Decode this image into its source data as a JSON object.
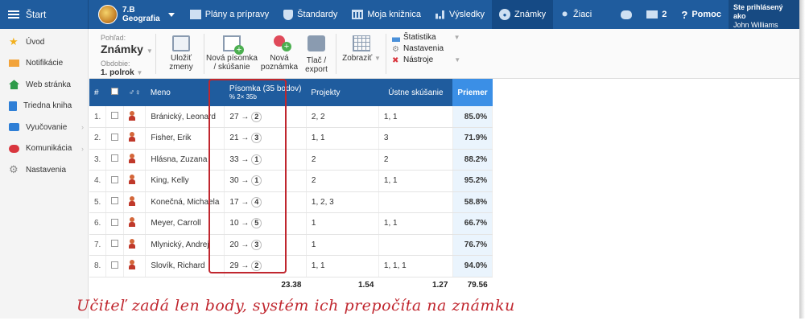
{
  "topbar": {
    "start_label": "Štart",
    "class_name": "7.B",
    "subject": "Geografia",
    "nav": [
      {
        "label": "Plány a prípravy",
        "icon": "board-icon"
      },
      {
        "label": "Štandardy",
        "icon": "shield-icon"
      },
      {
        "label": "Moja knižnica",
        "icon": "library-icon"
      },
      {
        "label": "Výsledky",
        "icon": "bar-chart-icon"
      },
      {
        "label": "Známky",
        "icon": "grade-icon",
        "active": true
      },
      {
        "label": "Žiaci",
        "icon": "students-icon"
      }
    ],
    "mail_count": "2",
    "help_label": "Pomoc",
    "user_prefix": "Ste prihlásený ako",
    "user_name": "John Williams"
  },
  "sidebar": {
    "items": [
      {
        "label": "Úvod",
        "icon": "star-icon"
      },
      {
        "label": "Notifikácie",
        "icon": "envelope-icon"
      },
      {
        "label": "Web stránka",
        "icon": "house-icon"
      },
      {
        "label": "Triedna kniha",
        "icon": "book-icon"
      },
      {
        "label": "Vyučovanie",
        "icon": "classroom-icon",
        "submenu": true
      },
      {
        "label": "Komunikácia",
        "icon": "chat-icon",
        "submenu": true
      },
      {
        "label": "Nastavenia",
        "icon": "gear-icon"
      }
    ]
  },
  "toolbar": {
    "view_label": "Pohľad:",
    "view_value": "Známky",
    "period_label": "Obdobie:",
    "period_value": "1. polrok",
    "save_line1": "Uložiť",
    "save_line2": "zmeny",
    "new_test_line1": "Nová písomka",
    "new_test_line2": "/ skúšanie",
    "new_note_line1": "Nová",
    "new_note_line2": "poznámka",
    "print_line1": "Tlač /",
    "print_line2": "export",
    "display_label": "Zobraziť",
    "stats_label": "Štatistika",
    "settings_label": "Nastavenia",
    "tools_label": "Nástroje"
  },
  "table": {
    "headers": {
      "num": "#",
      "gender": "♂♀",
      "name": "Meno",
      "test_title": "Písomka (35 bodov)",
      "test_sub": "%  2×  35b",
      "projects": "Projekty",
      "oral": "Ústne skúšanie",
      "average": "Priemer"
    },
    "rows": [
      {
        "num": "1.",
        "name": "Bránický, Leonard",
        "points": "27",
        "grade": "2",
        "projects": "2, 2",
        "oral": "1, 1",
        "avg": "85.0%"
      },
      {
        "num": "2.",
        "name": "Fisher, Erik",
        "points": "21",
        "grade": "3",
        "projects": "1, 1",
        "oral": "3",
        "avg": "71.9%"
      },
      {
        "num": "3.",
        "name": "Hlásna, Zuzana",
        "points": "33",
        "grade": "1",
        "projects": "2",
        "oral": "2",
        "avg": "88.2%"
      },
      {
        "num": "4.",
        "name": "King, Kelly",
        "points": "30",
        "grade": "1",
        "projects": "2",
        "oral": "1, 1",
        "avg": "95.2%"
      },
      {
        "num": "5.",
        "name": "Konečná, Michaela",
        "points": "17",
        "grade": "4",
        "projects": "1, 2, 3",
        "oral": "",
        "avg": "58.8%"
      },
      {
        "num": "6.",
        "name": "Meyer, Carroll",
        "points": "10",
        "grade": "5",
        "projects": "1",
        "oral": "1, 1",
        "avg": "66.7%"
      },
      {
        "num": "7.",
        "name": "Mlynický, Andrej",
        "points": "20",
        "grade": "3",
        "projects": "1",
        "oral": "",
        "avg": "76.7%"
      },
      {
        "num": "8.",
        "name": "Slovík, Richard",
        "points": "29",
        "grade": "2",
        "projects": "1, 1",
        "oral": "1, 1, 1",
        "avg": "94.0%"
      }
    ],
    "footer": {
      "test": "23.38",
      "projects": "1.54",
      "oral": "1.27",
      "average": "79.56"
    }
  },
  "arrow": "→",
  "caption": "Učiteľ zadá len body, systém ich prepočíta na známku",
  "colors": {
    "topbar": "#1f5c9e",
    "accent": "#3b8fe6",
    "highlight": "#c0262e"
  }
}
